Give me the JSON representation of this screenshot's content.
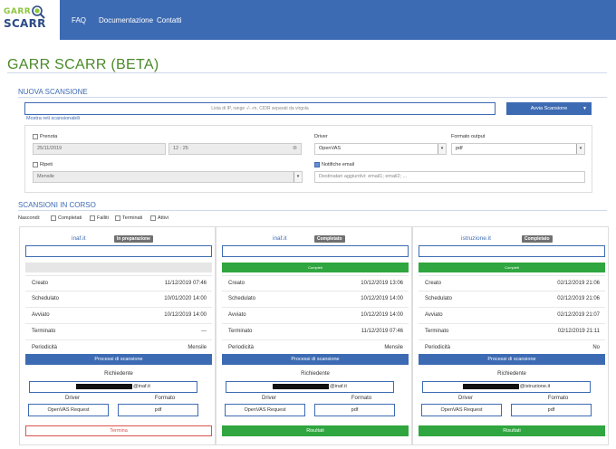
{
  "logo": {
    "line1": "GARR",
    "line2": "SCARR"
  },
  "nav": [
    {
      "label": "FAQ"
    },
    {
      "label": "Documentazione"
    },
    {
      "label": "Contatti"
    }
  ],
  "page_title": "GARR SCARR (BETA)",
  "new_scan": {
    "heading": "NUOVA SCANSIONE",
    "ip_placeholder": "Lista di IP, range -/-.-m, CIDR separati da virgola",
    "start_button": "Avvia Scansione",
    "show_networks_link": "Mostra reti scansionabili",
    "prenota_label": "Prenota",
    "date_value": "25/11/2019",
    "time_value": "12 : 25",
    "ripeti_label": "Ripeti",
    "repeat_value": "Mensile",
    "driver_label": "Driver",
    "driver_value": "OpenVAS",
    "format_label": "Formato output",
    "format_value": "pdf",
    "notify_label": "Notifiche email",
    "recipients_placeholder": "Destinatari aggiuntivi: email1; email2; ..."
  },
  "running": {
    "heading": "SCANSIONI IN CORSO",
    "hide_label": "Nascondi:",
    "filters": [
      "Completati",
      "Falliti",
      "Terminati",
      "Attivi"
    ]
  },
  "labels": {
    "created": "Creato",
    "scheduled": "Schedulato",
    "started": "Avviato",
    "ended": "Terminato",
    "periodicity": "Periodicità",
    "processes_button": "Processi di scansione",
    "requester": "Richiedente",
    "driver": "Driver",
    "format": "Formato"
  },
  "cards": [
    {
      "host": "inaf.it",
      "status": "In preparazione",
      "progress_label": "",
      "created": "11/12/2019 07:46",
      "scheduled": "10/01/2020 14:00",
      "started": "10/12/2019 14:00",
      "ended": "---",
      "periodicity": "Mensile",
      "requester_domain": "@inaf.it",
      "driver": "OpenVAS Request",
      "format": "pdf",
      "action": "Termina"
    },
    {
      "host": "inaf.it",
      "status": "Completato",
      "progress_label": "Completi",
      "created": "10/12/2019 13:06",
      "scheduled": "10/12/2019 14:00",
      "started": "10/12/2019 14:00",
      "ended": "11/12/2019 07:46",
      "periodicity": "Mensile",
      "requester_domain": "@inaf.it",
      "driver": "OpenVAS Request",
      "format": "pdf",
      "action": "Risultati"
    },
    {
      "host": "istruzione.it",
      "status": "Completato",
      "progress_label": "Completi",
      "created": "02/12/2019 21:06",
      "scheduled": "02/12/2019 21:06",
      "started": "02/12/2019 21:07",
      "ended": "02/12/2019 21:11",
      "periodicity": "No",
      "requester_domain": "@istruzione.it",
      "driver": "OpenVAS Request",
      "format": "pdf",
      "action": "Risultati"
    }
  ],
  "colors": {
    "brand_blue": "#3d6bb3",
    "title_green": "#4a8a2a",
    "success_green": "#2fa63f",
    "danger_red": "#d9534f",
    "badge_gray": "#707070"
  }
}
